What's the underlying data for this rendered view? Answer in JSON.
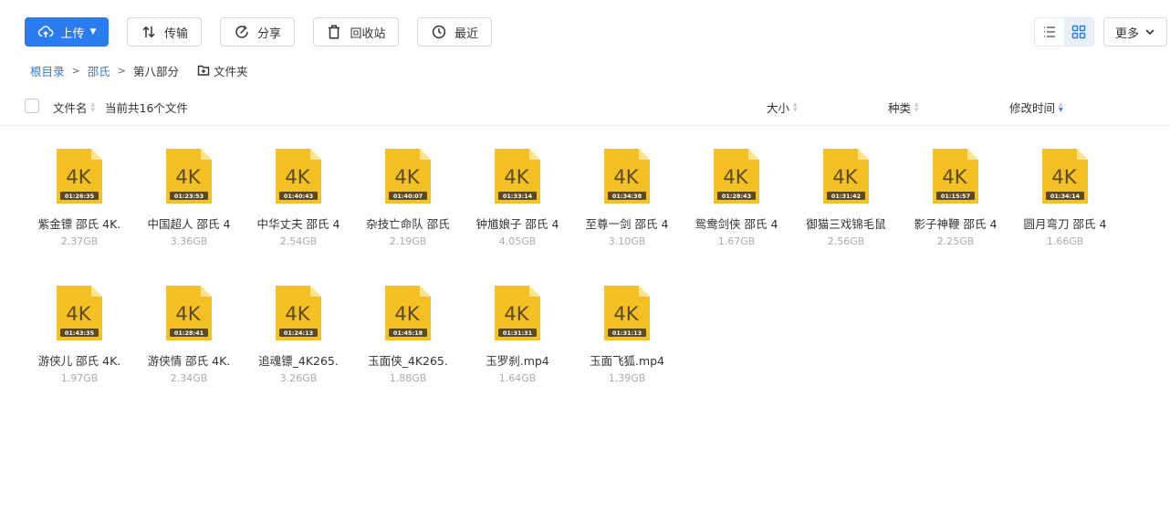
{
  "toolbar": {
    "upload_label": "上传",
    "transfer_label": "传输",
    "share_label": "分享",
    "recycle_label": "回收站",
    "recent_label": "最近",
    "more_label": "更多"
  },
  "breadcrumb": {
    "root": "根目录",
    "level1": "邵氏",
    "current": "第八部分",
    "new_folder": "文件夹"
  },
  "header": {
    "name_label": "文件名",
    "count_text": "当前共16个文件",
    "size_label": "大小",
    "type_label": "种类",
    "modified_label": "修改时间"
  },
  "thumb_label": "4K",
  "colors": {
    "accent": "#2b7cf0",
    "thumb_yellow": "#f5c023",
    "thumb_dark": "#5a4a1e"
  },
  "files": [
    {
      "name": "紫金镖  邵氏 4K.",
      "size": "2.37GB",
      "duration": "01:26:35"
    },
    {
      "name": "中国超人 邵氏 4",
      "size": "3.36GB",
      "duration": "01:23:53"
    },
    {
      "name": "中华丈夫 邵氏 4",
      "size": "2.54GB",
      "duration": "01:40:43"
    },
    {
      "name": "杂技亡命队 邵氏",
      "size": "2.19GB",
      "duration": "01:40:07"
    },
    {
      "name": "钟馗娘子  邵氏 4",
      "size": "4.05GB",
      "duration": "01:33:14"
    },
    {
      "name": "至尊一剑  邵氏 4",
      "size": "3.10GB",
      "duration": "01:34:38"
    },
    {
      "name": "鸳鸯剑侠  邵氏 4",
      "size": "1.67GB",
      "duration": "01:28:43"
    },
    {
      "name": "御猫三戏锦毛鼠",
      "size": "2.56GB",
      "duration": "01:31:42"
    },
    {
      "name": "影子神鞭  邵氏 4",
      "size": "2.25GB",
      "duration": "01:15:57"
    },
    {
      "name": "圆月弯刀 邵氏 4",
      "size": "1.66GB",
      "duration": "01:34:14"
    },
    {
      "name": "游侠儿  邵氏 4K.",
      "size": "1.97GB",
      "duration": "01:43:35"
    },
    {
      "name": "游侠情  邵氏 4K.",
      "size": "2.34GB",
      "duration": "01:28:41"
    },
    {
      "name": "追魂镖_4K265.",
      "size": "3.26GB",
      "duration": "01:24:13"
    },
    {
      "name": "玉面侠_4K265.",
      "size": "1.88GB",
      "duration": "01:45:18"
    },
    {
      "name": "玉罗刹.mp4",
      "size": "1.64GB",
      "duration": "01:31:31"
    },
    {
      "name": "玉面飞狐.mp4",
      "size": "1.39GB",
      "duration": "01:31:13"
    }
  ]
}
